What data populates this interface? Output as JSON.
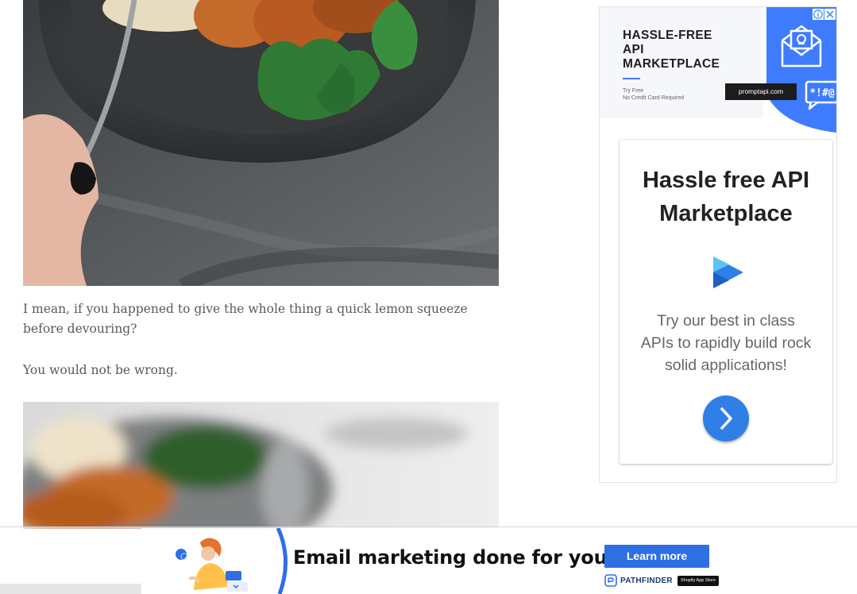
{
  "article": {
    "paragraph_1": "I mean, if you happened to give the whole thing a quick lemon squeeze before devouring?",
    "paragraph_2": "You would not be wrong."
  },
  "sidebar_ad": {
    "banner": {
      "headline_line1": "HASSLE-FREE",
      "headline_line2": "API",
      "headline_line3": "MARKETPLACE",
      "sub_line1": "Try Free",
      "sub_line2": "No Credit Card Required",
      "url_pill": "promptapi.com",
      "chat_glyphs": "*!#@"
    },
    "card": {
      "headline_line1": "Hassle free API",
      "headline_line2": "Marketplace",
      "body_line1": "Try our best in class",
      "body_line2": "APIs to rapidly build rock",
      "body_line3": "solid applications!"
    }
  },
  "bottom_ad": {
    "headline": "Email marketing done for you!",
    "button_label": "Learn more",
    "brand_name": "PATHFINDER",
    "store_badge": "Shopify App Store"
  },
  "colors": {
    "ad_blue": "#2f7fe6",
    "banner_blue": "#3f7bff",
    "text_gray": "#5a5a5a"
  },
  "icons": [
    "play-icon",
    "chevron-right-icon",
    "adchoices-icon",
    "close-icon",
    "envelope-icon",
    "chat-bubble-icon",
    "pathfinder-logo-icon"
  ]
}
